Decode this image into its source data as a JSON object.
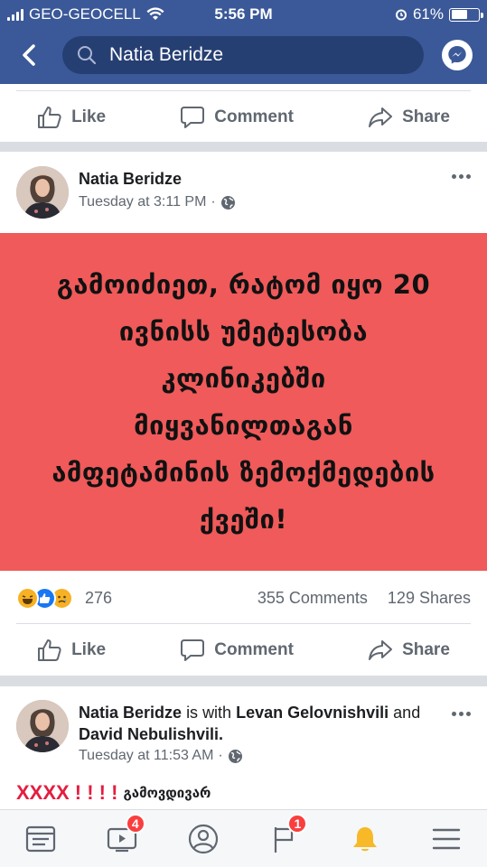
{
  "status": {
    "carrier": "GEO-GEOCELL",
    "time": "5:56 PM",
    "battery": "61%",
    "battery_level": 0.61
  },
  "search": {
    "query": "Natia Beridze"
  },
  "top_actions": {
    "like": "Like",
    "comment": "Comment",
    "share": "Share"
  },
  "post1": {
    "author": "Natia Beridze",
    "timestamp": "Tuesday at 3:11 PM",
    "separator": "·",
    "banner_lines": [
      "გამოიძიეთ, რატომ იყო 20",
      "ივნისს უმეტესობა",
      "კლინიკებში",
      "მიყვანილთაგან",
      "ამფეტამინის ზემოქმედების",
      "ქვეში!"
    ],
    "reaction_count": "276",
    "comments": "355 Comments",
    "shares": "129 Shares",
    "actions": {
      "like": "Like",
      "comment": "Comment",
      "share": "Share"
    }
  },
  "post2": {
    "author": "Natia Beridze",
    "with_text": "is with",
    "friend1": "Levan Gelovnishvili",
    "and_text": "and",
    "friend2": "David  Nebulishvili.",
    "timestamp": "Tuesday at 11:53 AM",
    "separator": "·",
    "caption_marks": "XXXX ! ! ! !",
    "caption_text": "გამოვდივარ"
  },
  "tabbar": {
    "watch_badge": "4",
    "notifications_badge": "1"
  },
  "colors": {
    "brand": "#3b5998",
    "banner": "#f05a5a",
    "badge": "#fa3e3e"
  }
}
